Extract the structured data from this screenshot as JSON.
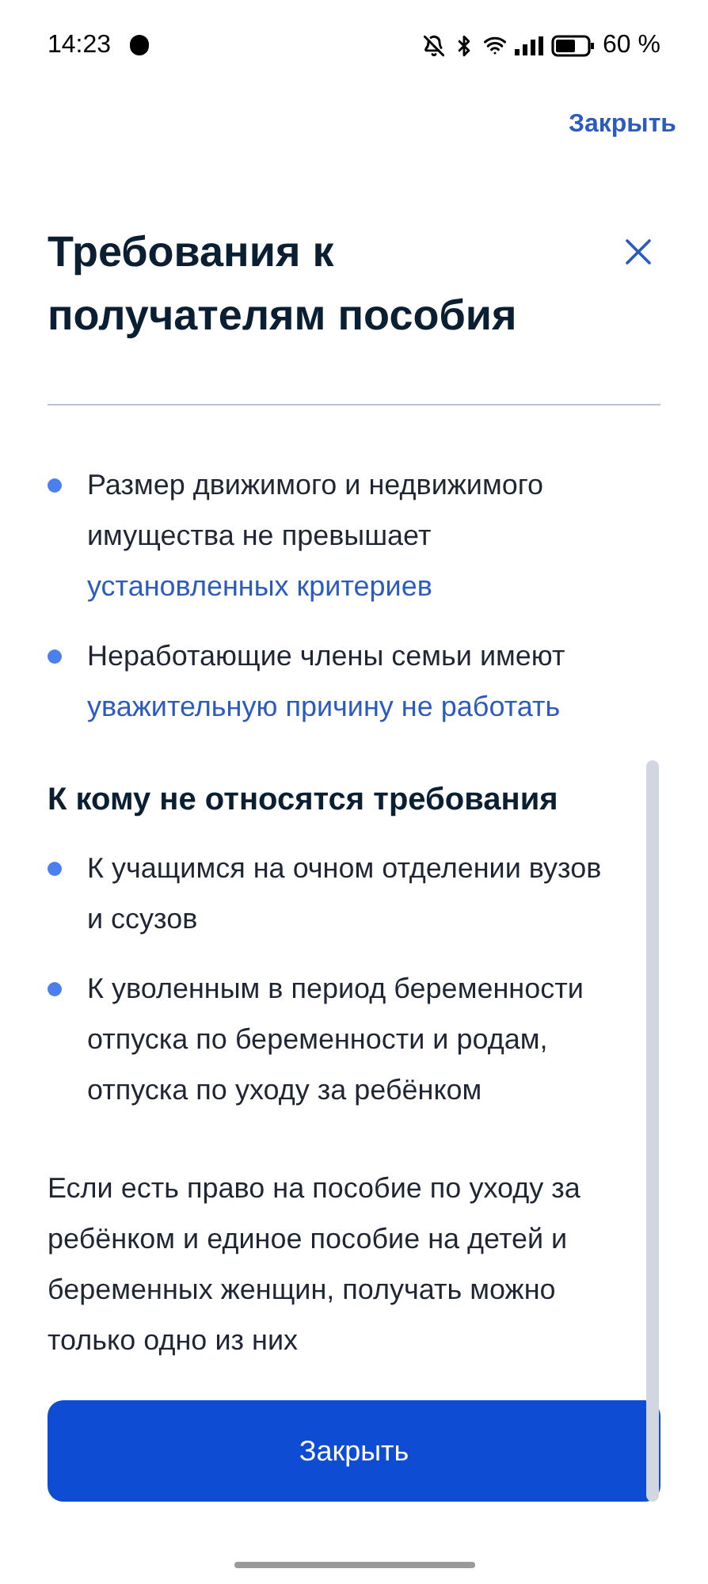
{
  "status_bar": {
    "time": "14:23",
    "battery": "60 %"
  },
  "top_link": "Закрыть",
  "title": "Требования к получателям пособия",
  "requirements": [
    {
      "text": "Размер движимого и недвижимого имущества не превышает",
      "link": "установленных критериев"
    },
    {
      "text": "Неработающие члены семьи имеют",
      "link": "уважительную причину не работать"
    }
  ],
  "exceptions": {
    "heading": "К кому не относятся требования",
    "items": [
      {
        "text": "К учащимся на очном отделении вузов и ссузов"
      },
      {
        "text": "К уволенным в период беременности отпуска по беременности и родам, отпуска по уходу за ребёнком"
      }
    ]
  },
  "note": "Если есть право на пособие по уходу за ребёнком и единое пособие на детей и беременных женщин, получать можно только одно из них",
  "button": "Закрыть"
}
